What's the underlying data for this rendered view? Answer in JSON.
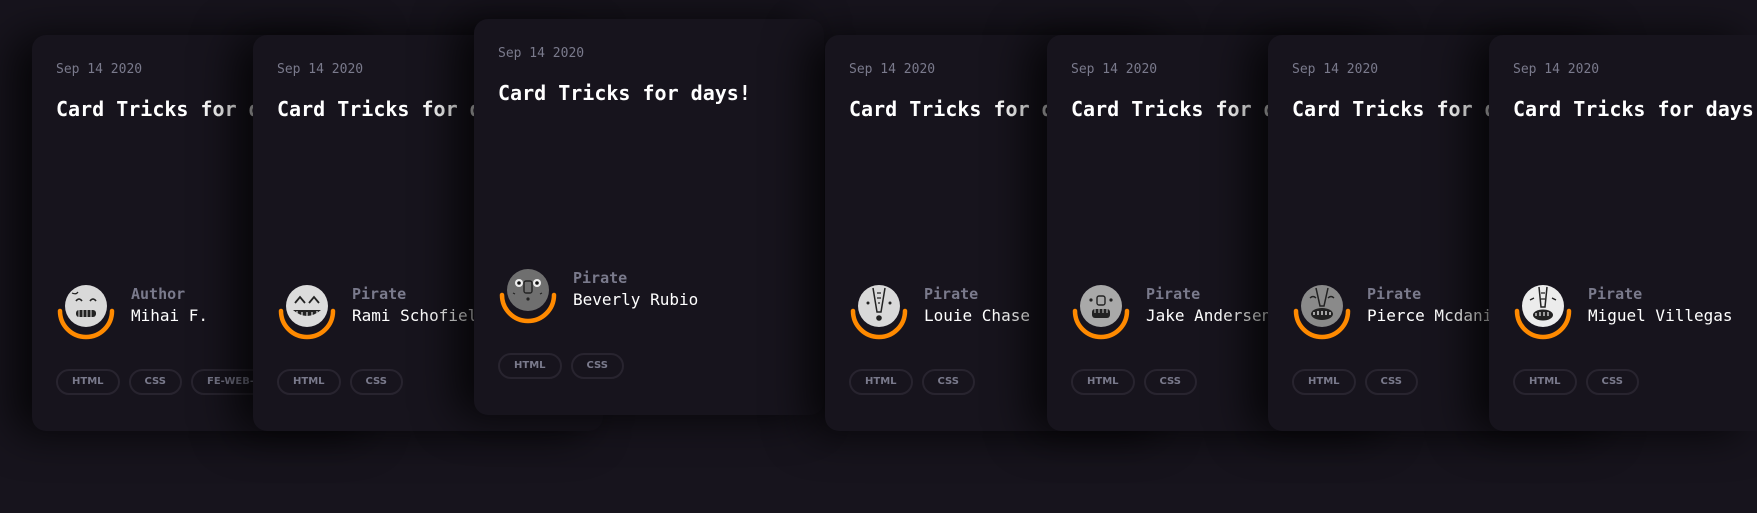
{
  "accent_color": "#ff8a00",
  "background_color": "#17141d",
  "cards": [
    {
      "date": "Sep 14 2020",
      "title": "Card Tricks for days!",
      "author_role": "Author",
      "author_name": "Mihai F.",
      "avatar_icon": "cartoon-face-icon",
      "tags": [
        "HTML",
        "CSS",
        "FE-WEB-DEV"
      ]
    },
    {
      "date": "Sep 14 2020",
      "title": "Card Tricks for days!",
      "author_role": "Pirate",
      "author_name": "Rami Schofield",
      "avatar_icon": "cartoon-face-icon",
      "tags": [
        "HTML",
        "CSS"
      ]
    },
    {
      "date": "Sep 14 2020",
      "title": "Card Tricks for days!",
      "author_role": "Pirate",
      "author_name": "Beverly Rubio",
      "avatar_icon": "cartoon-face-icon",
      "tags": [
        "HTML",
        "CSS"
      ]
    },
    {
      "date": "Sep 14 2020",
      "title": "Card Tricks for days!",
      "author_role": "Pirate",
      "author_name": "Louie Chase",
      "avatar_icon": "cartoon-face-icon",
      "tags": [
        "HTML",
        "CSS"
      ]
    },
    {
      "date": "Sep 14 2020",
      "title": "Card Tricks for days!",
      "author_role": "Pirate",
      "author_name": "Jake Andersen",
      "avatar_icon": "cartoon-face-icon",
      "tags": [
        "HTML",
        "CSS"
      ]
    },
    {
      "date": "Sep 14 2020",
      "title": "Card Tricks for days!",
      "author_role": "Pirate",
      "author_name": "Pierce Mcdaniel",
      "avatar_icon": "cartoon-face-icon",
      "tags": [
        "HTML",
        "CSS"
      ]
    },
    {
      "date": "Sep 14 2020",
      "title": "Card Tricks for days!",
      "author_role": "Pirate",
      "author_name": "Miguel Villegas",
      "avatar_icon": "cartoon-face-icon",
      "tags": [
        "HTML",
        "CSS"
      ]
    }
  ]
}
